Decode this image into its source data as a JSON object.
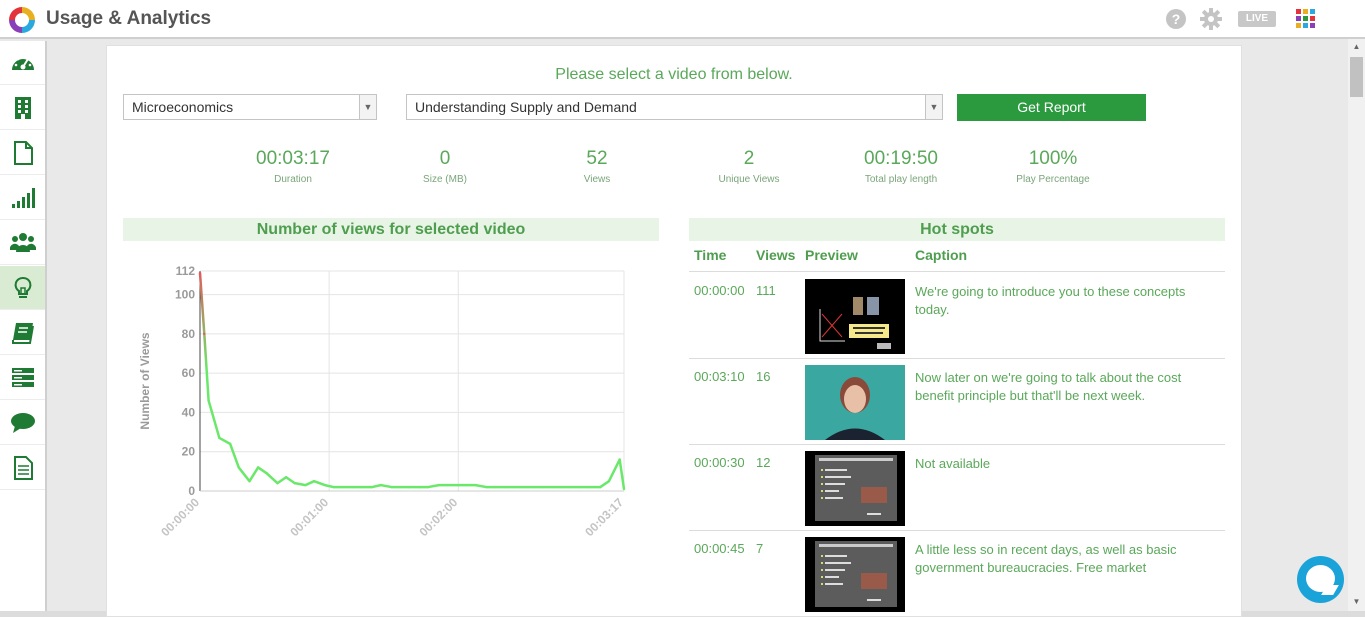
{
  "app": {
    "title": "Usage & Analytics",
    "live_label": "LIVE"
  },
  "icons": {
    "help": "help-circle-icon",
    "settings": "gear-icon",
    "apps": "app-grid-icon",
    "chat": "chat-bubble-icon"
  },
  "colors": {
    "accent_green": "#5aa85a",
    "button_green": "#2b9a3f",
    "line_green": "#6ae86a",
    "line_red": "#e05a5a"
  },
  "sidebar": {
    "items": [
      {
        "name": "dashboard-icon",
        "active": false
      },
      {
        "name": "building-icon",
        "active": false
      },
      {
        "name": "document-icon",
        "active": false
      },
      {
        "name": "signal-bars-icon",
        "active": false
      },
      {
        "name": "users-group-icon",
        "active": false
      },
      {
        "name": "lightbulb-icon",
        "active": true
      },
      {
        "name": "book-icon",
        "active": false
      },
      {
        "name": "server-stack-icon",
        "active": false
      },
      {
        "name": "speech-bubble-icon",
        "active": false
      },
      {
        "name": "report-icon",
        "active": false
      }
    ]
  },
  "main": {
    "prompt": "Please select a video from below.",
    "course_select": {
      "value": "Microeconomics"
    },
    "video_select": {
      "value": "Understanding Supply and Demand"
    },
    "report_button": "Get Report",
    "stats": [
      {
        "value": "00:03:17",
        "label": "Duration"
      },
      {
        "value": "0",
        "label": "Size (MB)"
      },
      {
        "value": "52",
        "label": "Views"
      },
      {
        "value": "2",
        "label": "Unique Views"
      },
      {
        "value": "00:19:50",
        "label": "Total play length"
      },
      {
        "value": "100%",
        "label": "Play Percentage"
      }
    ],
    "chart_title": "Number of views for selected video",
    "hotspots": {
      "title": "Hot spots",
      "headers": {
        "time": "Time",
        "views": "Views",
        "preview": "Preview",
        "caption": "Caption"
      },
      "rows": [
        {
          "time": "00:00:00",
          "views": "111",
          "preview": "title-slide",
          "caption": "We're going to introduce you to these concepts today."
        },
        {
          "time": "00:03:10",
          "views": "16",
          "preview": "presenter",
          "caption": "Now later on we're going to talk about the cost benefit principle but that'll be next week."
        },
        {
          "time": "00:00:30",
          "views": "12",
          "preview": "bullet-slide",
          "caption": "Not available"
        },
        {
          "time": "00:00:45",
          "views": "7",
          "preview": "bullet-slide",
          "caption": "A little less so in recent days, as well as basic government bureaucracies. Free market"
        }
      ]
    }
  },
  "chart_data": {
    "type": "line",
    "title": "Number of views for selected video",
    "xlabel": "",
    "ylabel": "Number of Views",
    "ylim": [
      0,
      112
    ],
    "yticks": [
      0,
      20,
      40,
      60,
      80,
      100,
      112
    ],
    "xlim": [
      0,
      197
    ],
    "xticks": [
      {
        "value": 0,
        "label": "00:00:00"
      },
      {
        "value": 60,
        "label": "00:01:00"
      },
      {
        "value": 120,
        "label": "00:02:00"
      },
      {
        "value": 197,
        "label": "00:03:17"
      }
    ],
    "grid": true,
    "series": [
      {
        "x": [
          0,
          2,
          4,
          9,
          14,
          18,
          23,
          27,
          31,
          36,
          40,
          44,
          49,
          53,
          58,
          62,
          66,
          71,
          75,
          80,
          84,
          89,
          93,
          97,
          102,
          106,
          111,
          115,
          120,
          124,
          128,
          133,
          137,
          142,
          146,
          151,
          155,
          159,
          164,
          168,
          172,
          177,
          181,
          186,
          190,
          195,
          197
        ],
        "y": [
          111,
          80,
          46,
          27,
          24,
          12,
          5,
          12,
          9,
          4,
          7,
          4,
          3,
          5,
          3,
          2,
          2,
          2,
          2,
          2,
          3,
          2,
          2,
          2,
          2,
          2,
          3,
          3,
          3,
          3,
          3,
          2,
          2,
          2,
          2,
          2,
          2,
          2,
          2,
          2,
          2,
          2,
          2,
          2,
          5,
          16,
          1
        ]
      }
    ]
  }
}
